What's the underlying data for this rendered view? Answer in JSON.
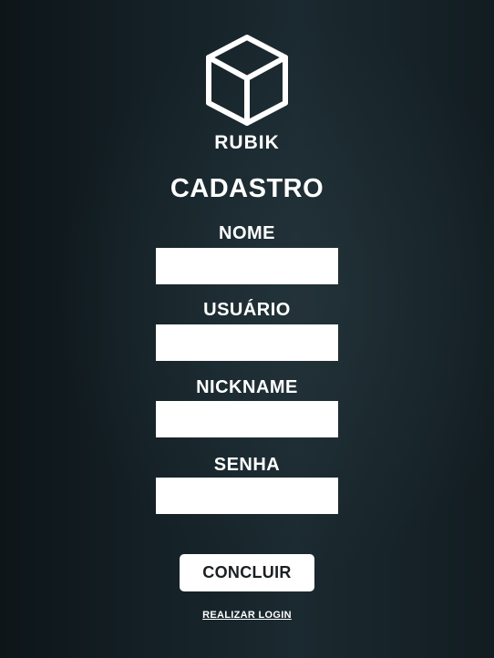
{
  "brand": {
    "name": "RUBIK",
    "logo_icon": "cube-icon"
  },
  "form": {
    "title": "CADASTRO",
    "fields": [
      {
        "label": "NOME",
        "value": ""
      },
      {
        "label": "USUÁRIO",
        "value": ""
      },
      {
        "label": "NICKNAME",
        "value": ""
      },
      {
        "label": "SENHA",
        "value": ""
      }
    ],
    "submit_label": "CONCLUIR",
    "login_link": "REALIZAR LOGIN"
  },
  "colors": {
    "background_dark": "#0d1519",
    "background_mid": "#1b2a30",
    "text": "#ffffff",
    "button_text": "#1b1f22"
  }
}
